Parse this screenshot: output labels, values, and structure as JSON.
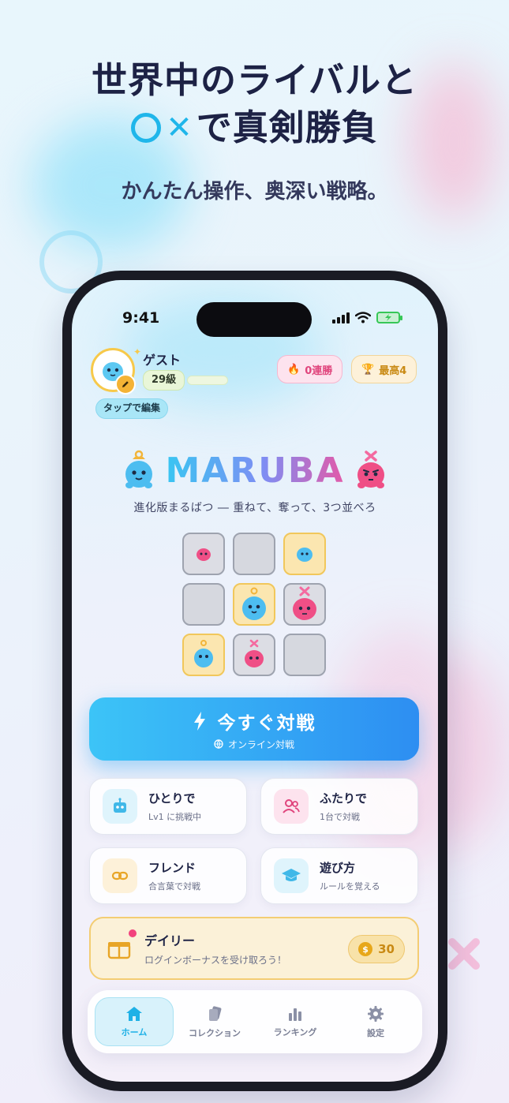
{
  "headline": {
    "line1": "世界中のライバルと",
    "line2_suffix": "で真剣勝負"
  },
  "subheadline": "かんたん操作、奥深い戦略。",
  "status_bar": {
    "time": "9:41"
  },
  "profile": {
    "name": "ゲスト",
    "level": "29級",
    "edit_hint": "タップで編集"
  },
  "stats": {
    "streak": "0連勝",
    "best": "最高4"
  },
  "logo": "MARUBA",
  "tagline": "進化版まるばつ ― 重ねて、奪って、3つ並べろ",
  "board": [
    [
      "pink-small",
      "empty",
      "blue-small"
    ],
    [
      "empty",
      "blue-large",
      "pink-large"
    ],
    [
      "blue-medium",
      "pink-medium",
      "empty"
    ]
  ],
  "play_button": {
    "label": "今すぐ対戦",
    "sub": "オンライン対戦"
  },
  "modes": {
    "solo": {
      "title": "ひとりで",
      "sub": "Lv1 に挑戦中"
    },
    "duo": {
      "title": "ふたりで",
      "sub": "1台で対戦"
    },
    "friend": {
      "title": "フレンド",
      "sub": "合言葉で対戦"
    },
    "howto": {
      "title": "遊び方",
      "sub": "ルールを覚える"
    }
  },
  "daily": {
    "title": "デイリー",
    "sub": "ログインボーナスを受け取ろう！",
    "coins": "30"
  },
  "tabs": [
    {
      "label": "ホーム",
      "icon": "home-icon",
      "active": true
    },
    {
      "label": "コレクション",
      "icon": "cards-icon"
    },
    {
      "label": "ランキング",
      "icon": "bar-chart-icon"
    },
    {
      "label": "設定",
      "icon": "gear-icon"
    }
  ],
  "colors": {
    "accent_blue": "#2d8ef2",
    "accent_cyan": "#1fb6ea",
    "pink": "#e0457d",
    "gold": "#f3cd73"
  }
}
